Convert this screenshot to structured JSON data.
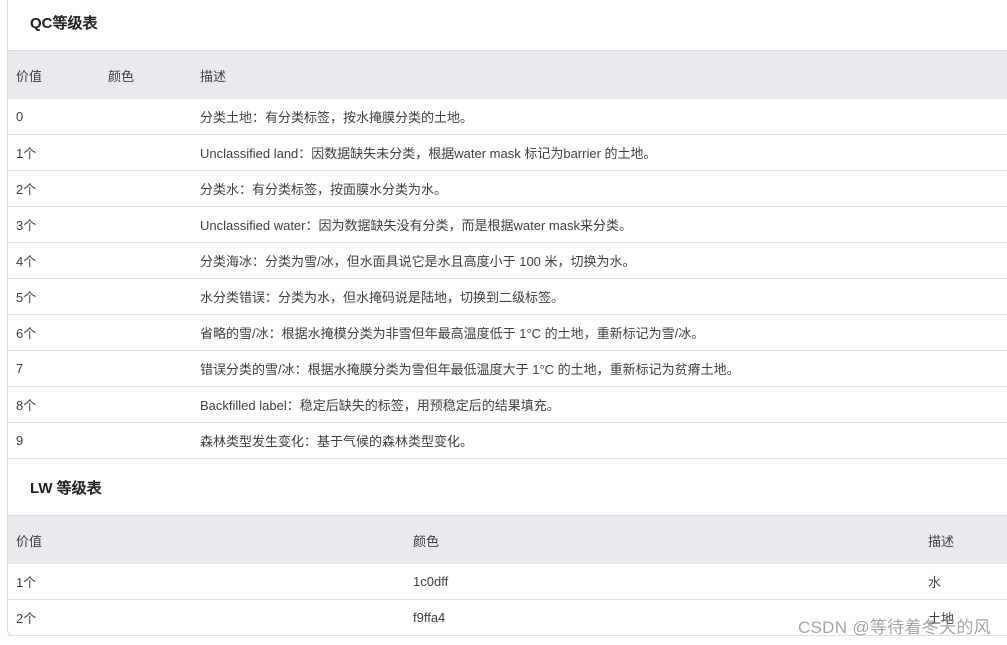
{
  "qc_section": {
    "title": "QC等级表",
    "headers": [
      "价值",
      "颜色",
      "描述"
    ],
    "rows": [
      {
        "value": "0",
        "color": "",
        "desc": "分类土地：有分类标签，按水掩膜分类的土地。"
      },
      {
        "value": "1个",
        "color": "",
        "desc": "Unclassified land：因数据缺失未分类，根据water mask 标记为barrier 的土地。"
      },
      {
        "value": "2个",
        "color": "",
        "desc": "分类水：有分类标签，按面膜水分类为水。"
      },
      {
        "value": "3个",
        "color": "",
        "desc": "Unclassified water：因为数据缺失没有分类，而是根据water mask来分类。"
      },
      {
        "value": "4个",
        "color": "",
        "desc": "分类海冰：分类为雪/冰，但水面具说它是水且高度小于 100 米，切换为水。"
      },
      {
        "value": "5个",
        "color": "",
        "desc": "水分类错误：分类为水，但水掩码说是陆地，切换到二级标签。"
      },
      {
        "value": "6个",
        "color": "",
        "desc": "省略的雪/冰：根据水掩模分类为非雪但年最高温度低于 1°C 的土地，重新标记为雪/冰。"
      },
      {
        "value": "7",
        "color": "",
        "desc": "错误分类的雪/冰：根据水掩膜分类为雪但年最低温度大于 1°C 的土地，重新标记为贫瘠土地。"
      },
      {
        "value": "8个",
        "color": "",
        "desc": "Backfilled label：稳定后缺失的标签，用预稳定后的结果填充。"
      },
      {
        "value": "9",
        "color": "",
        "desc": "森林类型发生变化：基于气候的森林类型变化。"
      }
    ]
  },
  "lw_section": {
    "title": "LW 等级表",
    "headers": [
      "价值",
      "颜色",
      "描述"
    ],
    "rows": [
      {
        "value": "1个",
        "color": "1c0dff",
        "desc": "水"
      },
      {
        "value": "2个",
        "color": "f9ffa4",
        "desc": "土地"
      }
    ]
  },
  "watermark": "CSDN @等待着冬天的风"
}
